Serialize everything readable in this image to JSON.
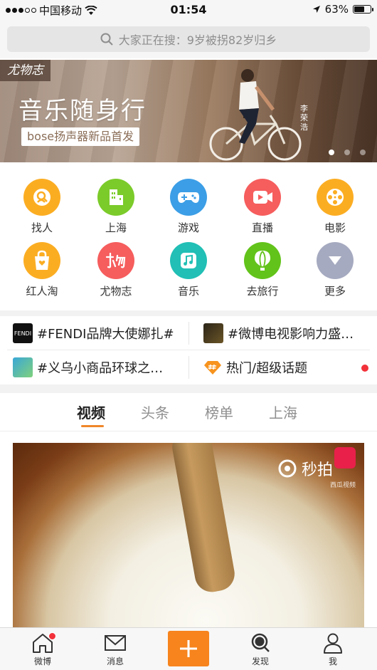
{
  "status_bar": {
    "carrier": "中国移动",
    "time": "01:54",
    "battery": "63%",
    "battery_level": 0.63
  },
  "search": {
    "placeholder": "大家正在搜：9岁被拐82岁归乡"
  },
  "banner": {
    "tag": "尤物志",
    "title": "音乐随身行",
    "subtitle": "bose扬声器新品首发",
    "credit": "李荣浩",
    "page_count": 3,
    "active_page": 1
  },
  "grid": {
    "items": [
      {
        "label": "找人",
        "icon": "find-people-icon",
        "color": "#fbad22"
      },
      {
        "label": "上海",
        "icon": "city-icon",
        "color": "#7bcb2a"
      },
      {
        "label": "游戏",
        "icon": "gamepad-icon",
        "color": "#3c9ee6"
      },
      {
        "label": "直播",
        "icon": "live-video-icon",
        "color": "#f65d5d"
      },
      {
        "label": "电影",
        "icon": "film-reel-icon",
        "color": "#fbad22"
      },
      {
        "label": "红人淘",
        "icon": "shopping-bag-icon",
        "color": "#fbad22"
      },
      {
        "label": "尤物志",
        "icon": "youwuzhi-icon",
        "color": "#f65d5d"
      },
      {
        "label": "音乐",
        "icon": "music-note-icon",
        "color": "#21bfb5"
      },
      {
        "label": "去旅行",
        "icon": "balloon-icon",
        "color": "#62c31a"
      },
      {
        "label": "更多",
        "icon": "chevron-down-icon",
        "color": "#a6aac0"
      }
    ]
  },
  "topics": [
    {
      "text": "#FENDI品牌大使娜扎#",
      "thumb": "FENDI"
    },
    {
      "text": "#微博电视影响力盛…",
      "thumb": ""
    },
    {
      "text": "#义乌小商品环球之…",
      "thumb": ""
    },
    {
      "text": "热门/超级话题",
      "thumb": ""
    }
  ],
  "tabs": [
    "视频",
    "头条",
    "榜单",
    "上海"
  ],
  "video": {
    "watermark": "秒拍",
    "watermark_sub": "西瓜视频"
  },
  "bottom_nav": {
    "home": "微博",
    "messages": "消息",
    "discover": "发现",
    "me": "我"
  },
  "colors": {
    "accent": "#f7841d",
    "badge": "#f2313a"
  }
}
